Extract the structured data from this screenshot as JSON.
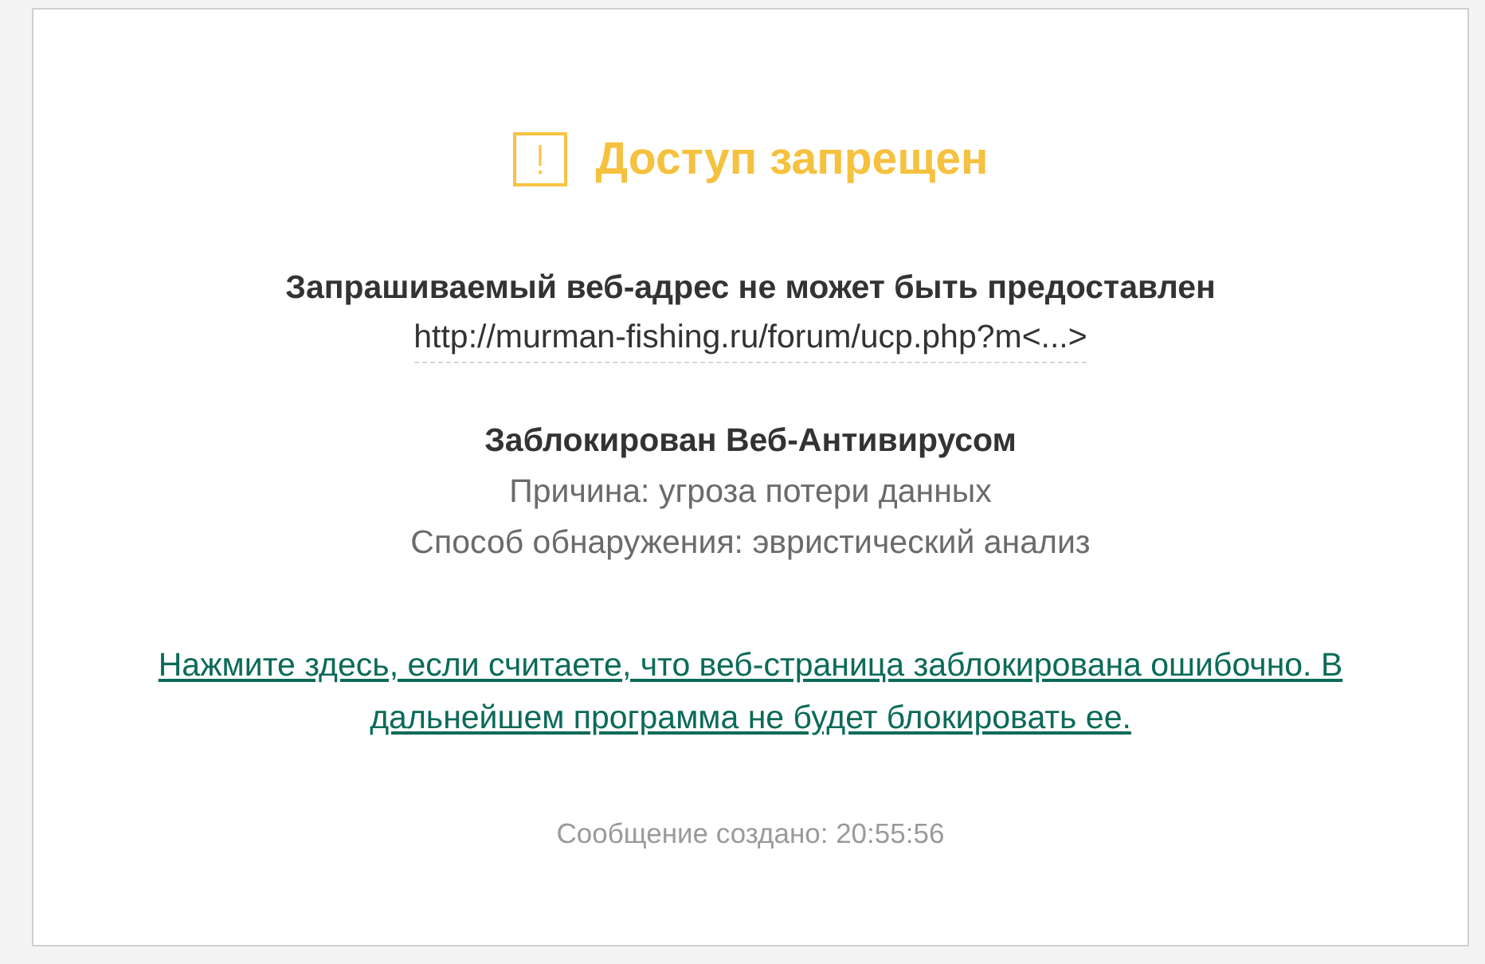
{
  "title": {
    "text": "Доступ запрещен"
  },
  "request": {
    "heading": "Запрашиваемый веб-адрес не может быть предоставлен",
    "url": "http://murman-fishing.ru/forum/ucp.php?m<...>"
  },
  "block_info": {
    "heading": "Заблокирован Веб-Антивирусом",
    "details": [
      "Причина: угроза потери данных",
      "Способ обнаружения: эвристический анализ"
    ]
  },
  "report_link": "Нажмите здесь, если считаете, что веб-страница заблокирована ошибочно. В дальнейшем программа не будет блокировать ее.",
  "footer": "Сообщение создано: 20:55:56"
}
